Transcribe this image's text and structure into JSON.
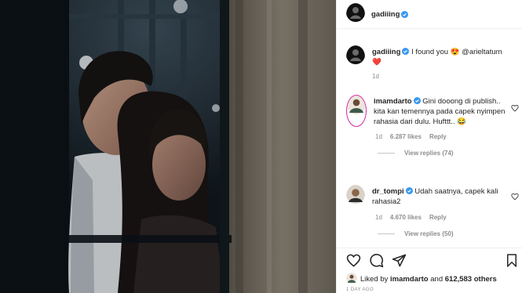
{
  "post": {
    "author": "gadiiing",
    "verified": true
  },
  "caption": {
    "username": "gadiiing",
    "text": "I found you 😍 @arieltatum",
    "emoji_heart": "❤️",
    "time": "1d"
  },
  "comments": [
    {
      "username": "imamdarto",
      "verified": true,
      "text": "Gini dooong di publish.. kita kan temennya pada capek nyimpen rahasia dari dulu. Hufttt.. 😂",
      "time": "1d",
      "likes": "6.287 likes",
      "reply_label": "Reply",
      "view_replies": "View replies (74)"
    },
    {
      "username": "dr_tompi",
      "verified": true,
      "text": "Udah saatnya, capek kali rahasia2",
      "time": "1d",
      "likes": "4.670 likes",
      "reply_label": "Reply",
      "view_replies": "View replies (50)"
    }
  ],
  "actions": {
    "icons": [
      "heart-icon",
      "comment-icon",
      "share-icon",
      "bookmark-icon"
    ]
  },
  "likes": {
    "prefix": "Liked by",
    "user": "imamdarto",
    "joiner": "and",
    "others": "612,583 others"
  },
  "time_ago": "1 DAY AGO",
  "colors": {
    "verified": "#3897f0",
    "secondary_text": "#8e8e8e",
    "primary_text": "#262626"
  }
}
